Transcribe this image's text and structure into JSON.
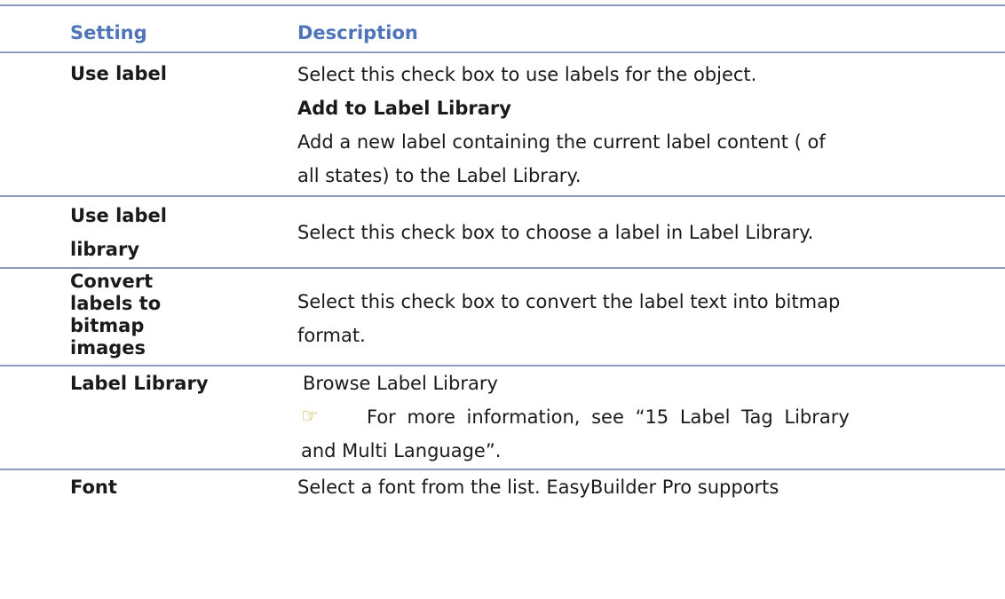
{
  "header": {
    "setting": "Setting",
    "description": "Description"
  },
  "rows": [
    {
      "setting": "Use label",
      "lines": [
        "Select this check box to use labels for the object.",
        "Add to Label Library",
        "Add a new label containing the current label content ( of",
        "all states) to the Label Library."
      ]
    },
    {
      "setting_lines": [
        "Use label",
        "library"
      ],
      "lines": [
        "Select this check box to choose a label in Label Library."
      ]
    },
    {
      "setting_lines": [
        "Convert",
        "labels to",
        "bitmap",
        "images"
      ],
      "lines": [
        "Select this check box to convert the label text into bitmap",
        "format."
      ]
    },
    {
      "setting": "Label Library",
      "lines": [
        "Browse Label Library",
        "For more information, see “15 Label Tag Library",
        "and Multi Language”."
      ],
      "icon": "pointing-hand-icon"
    },
    {
      "setting": "Font",
      "lines": [
        "Select a font from the list. EasyBuilder Pro supports"
      ]
    }
  ],
  "colors": {
    "header_text": "#4f74b9",
    "rule": "#8a9bbf",
    "icon": "#c59a2c"
  }
}
